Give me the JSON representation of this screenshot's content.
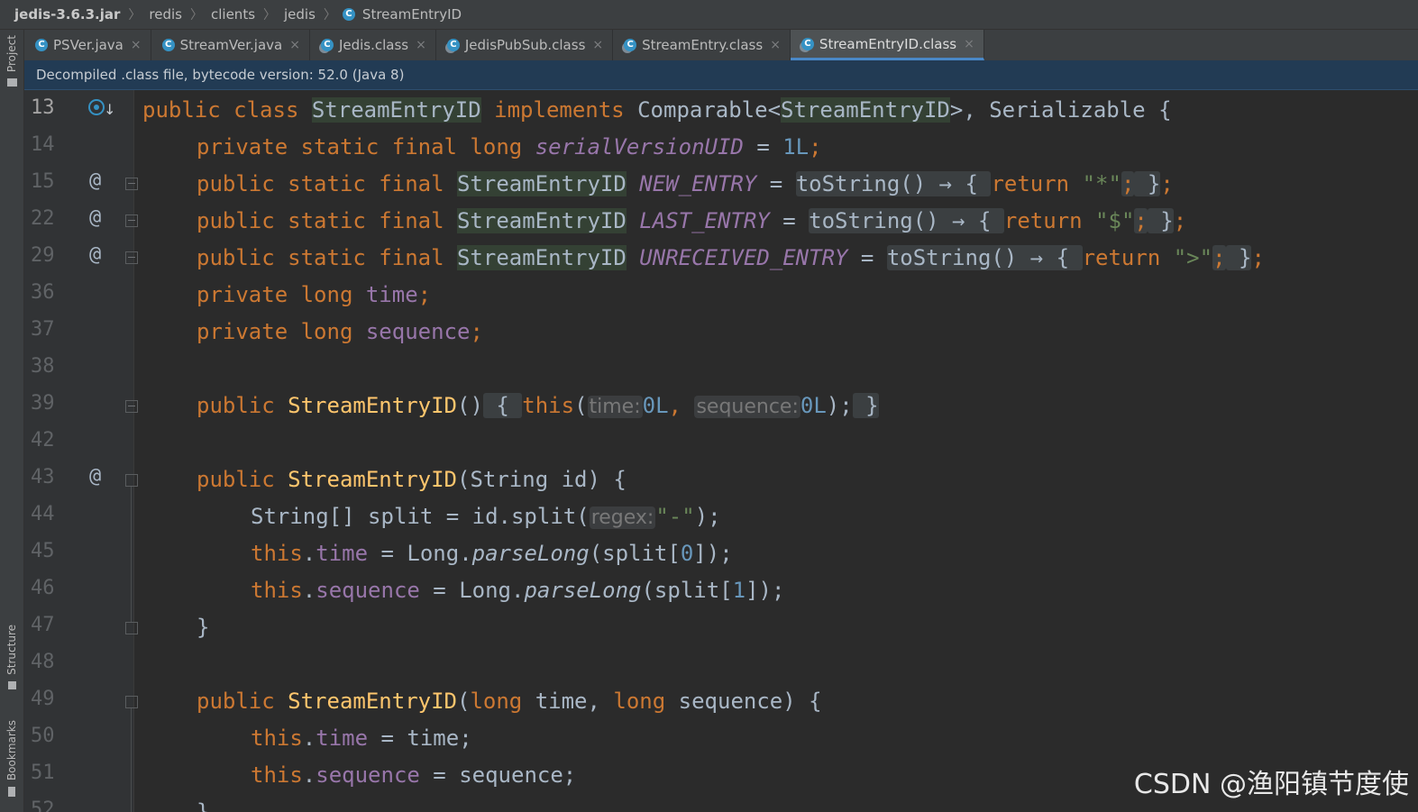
{
  "breadcrumb": {
    "items": [
      "jedis-3.6.3.jar",
      "redis",
      "clients",
      "jedis",
      "StreamEntryID"
    ],
    "separator": "〉"
  },
  "tool_stripe": {
    "project": "Project",
    "structure": "Structure",
    "bookmarks": "Bookmarks"
  },
  "tabs": [
    {
      "label": "PSVer.java",
      "active": false
    },
    {
      "label": "StreamVer.java",
      "active": false
    },
    {
      "label": "Jedis.class",
      "active": false
    },
    {
      "label": "JedisPubSub.class",
      "active": false
    },
    {
      "label": "StreamEntry.class",
      "active": false
    },
    {
      "label": "StreamEntryID.class",
      "active": true
    }
  ],
  "tab_close_glyph": "×",
  "class_icon_letter": "C",
  "notice": "Decompiled .class file, bytecode version: 52.0 (Java 8)",
  "gutter": {
    "lines": [
      "13",
      "14",
      "15",
      "22",
      "29",
      "36",
      "37",
      "38",
      "39",
      "42",
      "43",
      "44",
      "45",
      "46",
      "47",
      "48",
      "49",
      "50",
      "51",
      "52"
    ],
    "override_marker": "@"
  },
  "code": {
    "l13": {
      "kw1": "public class ",
      "cls": "StreamEntryID",
      "sp1": " ",
      "impl": "implements",
      "rest": " Comparable<",
      "gen": "StreamEntryID",
      "tail": ">, Serializable {"
    },
    "l14": {
      "kw": "private static final long ",
      "fld": "serialVersionUID",
      "eq": " = ",
      "num": "1L",
      "semi": ";"
    },
    "l15": {
      "kw": "public static final ",
      "type": "StreamEntryID",
      "sp": " ",
      "fld": "NEW_ENTRY",
      "eq": " = ",
      "fold": "toString() → { ",
      "ret": "return ",
      "str": "\"*\"",
      "semi": ";",
      "close": " }",
      "end": ";"
    },
    "l22": {
      "kw": "public static final ",
      "type": "StreamEntryID",
      "sp": " ",
      "fld": "LAST_ENTRY",
      "eq": " = ",
      "fold": "toString() → { ",
      "ret": "return ",
      "str": "\"$\"",
      "semi": ";",
      "close": " }",
      "end": ";"
    },
    "l29": {
      "kw": "public static final ",
      "type": "StreamEntryID",
      "sp": " ",
      "fld": "UNRECEIVED_ENTRY",
      "eq": " = ",
      "fold": "toString() → { ",
      "ret": "return ",
      "str": "\">\"",
      "semi": ";",
      "close": " }",
      "end": ";"
    },
    "l36": {
      "kw": "private long ",
      "fld": "time",
      "semi": ";"
    },
    "l37": {
      "kw": "private long ",
      "fld": "sequence",
      "semi": ";"
    },
    "l39": {
      "kw": "public ",
      "fn": "StreamEntryID",
      "paren": "()",
      "ob": " { ",
      "kw2": "this",
      "op": "(",
      "hint1": "time:",
      "n1": "0L",
      "comma": ", ",
      "hint2": "sequence:",
      "n2": "0L",
      "cp": ");",
      "cb": " }"
    },
    "l43": {
      "kw": "public ",
      "fn": "StreamEntryID",
      "rest": "(String id) {"
    },
    "l44": {
      "a": "String[] split = id.split(",
      "hint": "regex:",
      "str": "\"-\"",
      "b": ");"
    },
    "l45": {
      "kw": "this",
      "dot": ".",
      "fld": "time",
      "a": " = Long.",
      "m": "parseLong",
      "b": "(split[",
      "num": "0",
      "c": "]);"
    },
    "l46": {
      "kw": "this",
      "dot": ".",
      "fld": "sequence",
      "a": " = Long.",
      "m": "parseLong",
      "b": "(split[",
      "num": "1",
      "c": "]);"
    },
    "l47": {
      "a": "}"
    },
    "l49": {
      "kw": "public ",
      "fn": "StreamEntryID",
      "a": "(",
      "kw2": "long",
      "b": " time, ",
      "kw3": "long",
      "c": " sequence) {"
    },
    "l50": {
      "kw": "this",
      "dot": ".",
      "fld": "time",
      "a": " = time;"
    },
    "l51": {
      "kw": "this",
      "dot": ".",
      "fld": "sequence",
      "a": " = sequence;"
    },
    "l52": {
      "a": "}"
    }
  },
  "watermark": "CSDN @渔阳镇节度使"
}
